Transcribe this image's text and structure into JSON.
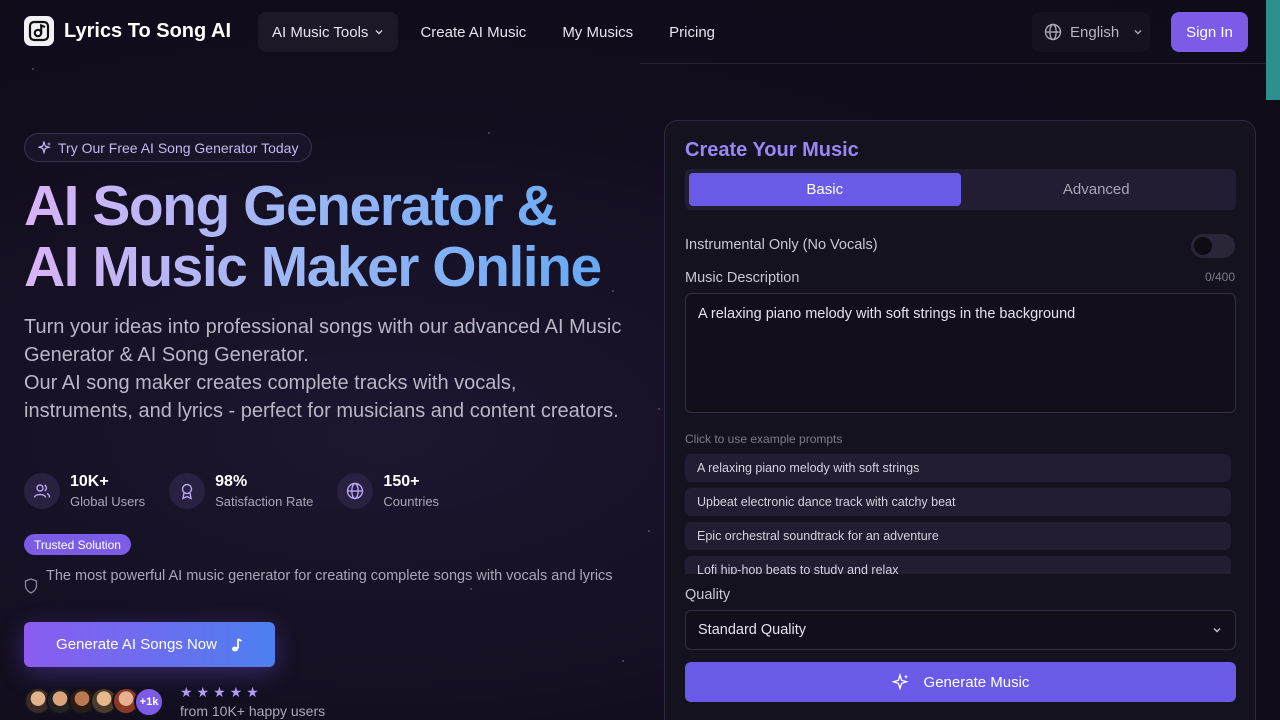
{
  "header": {
    "brand": "Lyrics To Song AI",
    "nav": [
      {
        "label": "AI Music Tools"
      },
      {
        "label": "Create AI Music"
      },
      {
        "label": "My Musics"
      },
      {
        "label": "Pricing"
      }
    ],
    "language": "English",
    "signin_label": "Sign In"
  },
  "hero": {
    "badge": "Try Our Free AI Song Generator Today",
    "title_line1": "AI Song Generator &",
    "title_line2": "AI Music Maker Online",
    "desc_line1": "Turn your ideas into professional songs with our advanced AI Music Generator & AI Song Generator.",
    "desc_line2": "Our AI song maker creates complete tracks with vocals, instruments, and lyrics - perfect for musicians and content creators.",
    "stats": [
      {
        "value": "10K+",
        "label": "Global Users",
        "icon": "users-icon"
      },
      {
        "value": "98%",
        "label": "Satisfaction Rate",
        "icon": "award-icon"
      },
      {
        "value": "150+",
        "label": "Countries",
        "icon": "globe-icon"
      }
    ],
    "trusted_badge": "Trusted Solution",
    "trusted_text": "The most powerful AI music generator for creating complete songs with vocals and lyrics",
    "cta_label": "Generate AI Songs Now",
    "avatar_more": "+1k",
    "rating_stars": "★★★★★",
    "social_text": "from 10K+ happy users"
  },
  "panel": {
    "title": "Create Your Music",
    "tabs": [
      {
        "label": "Basic"
      },
      {
        "label": "Advanced"
      }
    ],
    "instrumental_label": "Instrumental Only (No Vocals)",
    "instrumental_on": false,
    "description_label": "Music Description",
    "char_counter": "0/400",
    "description_value": "A relaxing piano melody with soft strings in the background",
    "examples_label": "Click to use example prompts",
    "examples": [
      "A relaxing piano melody with soft strings",
      "Upbeat electronic dance track with catchy beat",
      "Epic orchestral soundtrack for an adventure",
      "Lofi hip-hop beats to study and relax"
    ],
    "quality_label": "Quality",
    "quality_value": "Standard Quality",
    "generate_label": "Generate Music"
  },
  "colors": {
    "accent": "#7c5ce6",
    "button": "#6a5ae8",
    "background": "#120d1d",
    "teal_scroll": "#2e8f8c"
  }
}
